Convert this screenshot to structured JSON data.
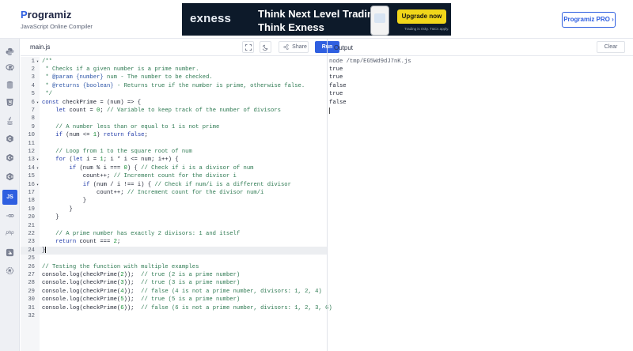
{
  "header": {
    "logo_name": "rogramiz",
    "logo_mark": "P",
    "logo_subtitle": "JavaScript Online Compiler",
    "pro_button": "Programiz PRO ›"
  },
  "ad": {
    "brand": "exness",
    "headline_1": "Think Next Level Trading",
    "headline_2": "Think Exness",
    "cta": "Upgrade now",
    "fine_print": "Trading is risky. T&Cs apply.",
    "close": "×"
  },
  "sidebar": {
    "items": [
      {
        "icon": "python-icon"
      },
      {
        "icon": "r-icon"
      },
      {
        "icon": "sql-icon"
      },
      {
        "icon": "html-icon"
      },
      {
        "icon": "java-icon"
      },
      {
        "icon": "c-icon"
      },
      {
        "icon": "cpp-icon"
      },
      {
        "icon": "csharp-icon"
      },
      {
        "icon": "js-icon",
        "label": "JS",
        "active": true
      },
      {
        "icon": "go-icon"
      },
      {
        "icon": "php-icon",
        "label": "php"
      },
      {
        "icon": "swift-icon"
      },
      {
        "icon": "rust-icon"
      }
    ]
  },
  "editor": {
    "tab": "main.js",
    "fullscreen_icon": "fullscreen-icon",
    "theme_icon": "moon-icon",
    "share": "Share",
    "run": "Run",
    "current_line": 24,
    "lines": [
      {
        "n": "1",
        "fold": "▾",
        "seg": [
          [
            "c",
            "/**"
          ]
        ]
      },
      {
        "n": "2",
        "seg": [
          [
            "c",
            " * Checks if a given number is a prime number."
          ]
        ]
      },
      {
        "n": "3",
        "seg": [
          [
            "c",
            " * "
          ],
          [
            "d",
            "@param"
          ],
          [
            "c",
            " "
          ],
          [
            "d",
            "{number}"
          ],
          [
            "c",
            " num - The number to be checked."
          ]
        ]
      },
      {
        "n": "4",
        "seg": [
          [
            "c",
            " * "
          ],
          [
            "d",
            "@returns"
          ],
          [
            "c",
            " "
          ],
          [
            "d",
            "{boolean}"
          ],
          [
            "c",
            " - Returns true if the number is prime, otherwise false."
          ]
        ]
      },
      {
        "n": "5",
        "seg": [
          [
            "c",
            " */"
          ]
        ]
      },
      {
        "n": "6",
        "fold": "▾",
        "seg": [
          [
            "k",
            "const"
          ],
          [
            "f",
            " checkPrime = (num) => {"
          ]
        ]
      },
      {
        "n": "7",
        "seg": [
          [
            "f",
            "    "
          ],
          [
            "k",
            "let"
          ],
          [
            "f",
            " count = "
          ],
          [
            "n",
            "0"
          ],
          [
            "f",
            "; "
          ],
          [
            "c",
            "// Variable to keep track of the number of divisors"
          ]
        ]
      },
      {
        "n": "8",
        "seg": [
          [
            "f",
            ""
          ]
        ]
      },
      {
        "n": "9",
        "seg": [
          [
            "f",
            "    "
          ],
          [
            "c",
            "// A number less than or equal to 1 is not prime"
          ]
        ]
      },
      {
        "n": "10",
        "seg": [
          [
            "f",
            "    "
          ],
          [
            "k",
            "if"
          ],
          [
            "f",
            " (num <= "
          ],
          [
            "n",
            "1"
          ],
          [
            "f",
            ") "
          ],
          [
            "k",
            "return"
          ],
          [
            "f",
            " "
          ],
          [
            "k",
            "false"
          ],
          [
            "f",
            ";"
          ]
        ]
      },
      {
        "n": "11",
        "seg": [
          [
            "f",
            ""
          ]
        ]
      },
      {
        "n": "12",
        "seg": [
          [
            "f",
            "    "
          ],
          [
            "c",
            "// Loop from 1 to the square root of num"
          ]
        ]
      },
      {
        "n": "13",
        "fold": "▾",
        "seg": [
          [
            "f",
            "    "
          ],
          [
            "k",
            "for"
          ],
          [
            "f",
            " ("
          ],
          [
            "k",
            "let"
          ],
          [
            "f",
            " i = "
          ],
          [
            "n",
            "1"
          ],
          [
            "f",
            "; i * i <= num; i++) {"
          ]
        ]
      },
      {
        "n": "14",
        "fold": "▾",
        "seg": [
          [
            "f",
            "        "
          ],
          [
            "k",
            "if"
          ],
          [
            "f",
            " (num % i === "
          ],
          [
            "n",
            "0"
          ],
          [
            "f",
            ") { "
          ],
          [
            "c",
            "// Check if i is a divisor of num"
          ]
        ]
      },
      {
        "n": "15",
        "seg": [
          [
            "f",
            "            count++; "
          ],
          [
            "c",
            "// Increment count for the divisor i"
          ]
        ]
      },
      {
        "n": "16",
        "fold": "▾",
        "seg": [
          [
            "f",
            "            "
          ],
          [
            "k",
            "if"
          ],
          [
            "f",
            " (num / i !== i) { "
          ],
          [
            "c",
            "// Check if num/i is a different divisor"
          ]
        ]
      },
      {
        "n": "17",
        "seg": [
          [
            "f",
            "                count++; "
          ],
          [
            "c",
            "// Increment count for the divisor num/i"
          ]
        ]
      },
      {
        "n": "18",
        "seg": [
          [
            "f",
            "            }"
          ]
        ]
      },
      {
        "n": "19",
        "seg": [
          [
            "f",
            "        }"
          ]
        ]
      },
      {
        "n": "20",
        "seg": [
          [
            "f",
            "    }"
          ]
        ]
      },
      {
        "n": "21",
        "seg": [
          [
            "f",
            ""
          ]
        ]
      },
      {
        "n": "22",
        "seg": [
          [
            "f",
            "    "
          ],
          [
            "c",
            "// A prime number has exactly 2 divisors: 1 and itself"
          ]
        ]
      },
      {
        "n": "23",
        "seg": [
          [
            "f",
            "    "
          ],
          [
            "k",
            "return"
          ],
          [
            "f",
            " count === "
          ],
          [
            "n",
            "2"
          ],
          [
            "f",
            ";"
          ]
        ]
      },
      {
        "n": "24",
        "seg": [
          [
            "f",
            "}"
          ]
        ]
      },
      {
        "n": "25",
        "seg": [
          [
            "f",
            ""
          ]
        ]
      },
      {
        "n": "26",
        "seg": [
          [
            "c",
            "// Testing the function with multiple examples"
          ]
        ]
      },
      {
        "n": "27",
        "seg": [
          [
            "f",
            "console.log(checkPrime("
          ],
          [
            "n",
            "2"
          ],
          [
            "f",
            "));  "
          ],
          [
            "c",
            "// true (2 is a prime number)"
          ]
        ]
      },
      {
        "n": "28",
        "seg": [
          [
            "f",
            "console.log(checkPrime("
          ],
          [
            "n",
            "3"
          ],
          [
            "f",
            "));  "
          ],
          [
            "c",
            "// true (3 is a prime number)"
          ]
        ]
      },
      {
        "n": "29",
        "seg": [
          [
            "f",
            "console.log(checkPrime("
          ],
          [
            "n",
            "4"
          ],
          [
            "f",
            "));  "
          ],
          [
            "c",
            "// false (4 is not a prime number, divisors: 1, 2, 4)"
          ]
        ]
      },
      {
        "n": "30",
        "seg": [
          [
            "f",
            "console.log(checkPrime("
          ],
          [
            "n",
            "5"
          ],
          [
            "f",
            "));  "
          ],
          [
            "c",
            "// true (5 is a prime number)"
          ]
        ]
      },
      {
        "n": "31",
        "seg": [
          [
            "f",
            "console.log(checkPrime("
          ],
          [
            "n",
            "6"
          ],
          [
            "f",
            "));  "
          ],
          [
            "c",
            "// false (6 is not a prime number, divisors: 1, 2, 3, 6)"
          ]
        ]
      },
      {
        "n": "32",
        "seg": [
          [
            "f",
            ""
          ]
        ]
      }
    ]
  },
  "output": {
    "title": "Output",
    "clear": "Clear",
    "lines": [
      {
        "text": "node /tmp/EG5Wd9dJ7nK.js",
        "kind": "cmd"
      },
      {
        "text": "true",
        "kind": "out"
      },
      {
        "text": "true",
        "kind": "out"
      },
      {
        "text": "false",
        "kind": "out"
      },
      {
        "text": "true",
        "kind": "out"
      },
      {
        "text": "false",
        "kind": "out"
      }
    ]
  },
  "colors": {
    "accent": "#2f5fe0",
    "keyword": "#1f3aa8",
    "number": "#0f8a2f",
    "comment": "#2e7a52"
  }
}
